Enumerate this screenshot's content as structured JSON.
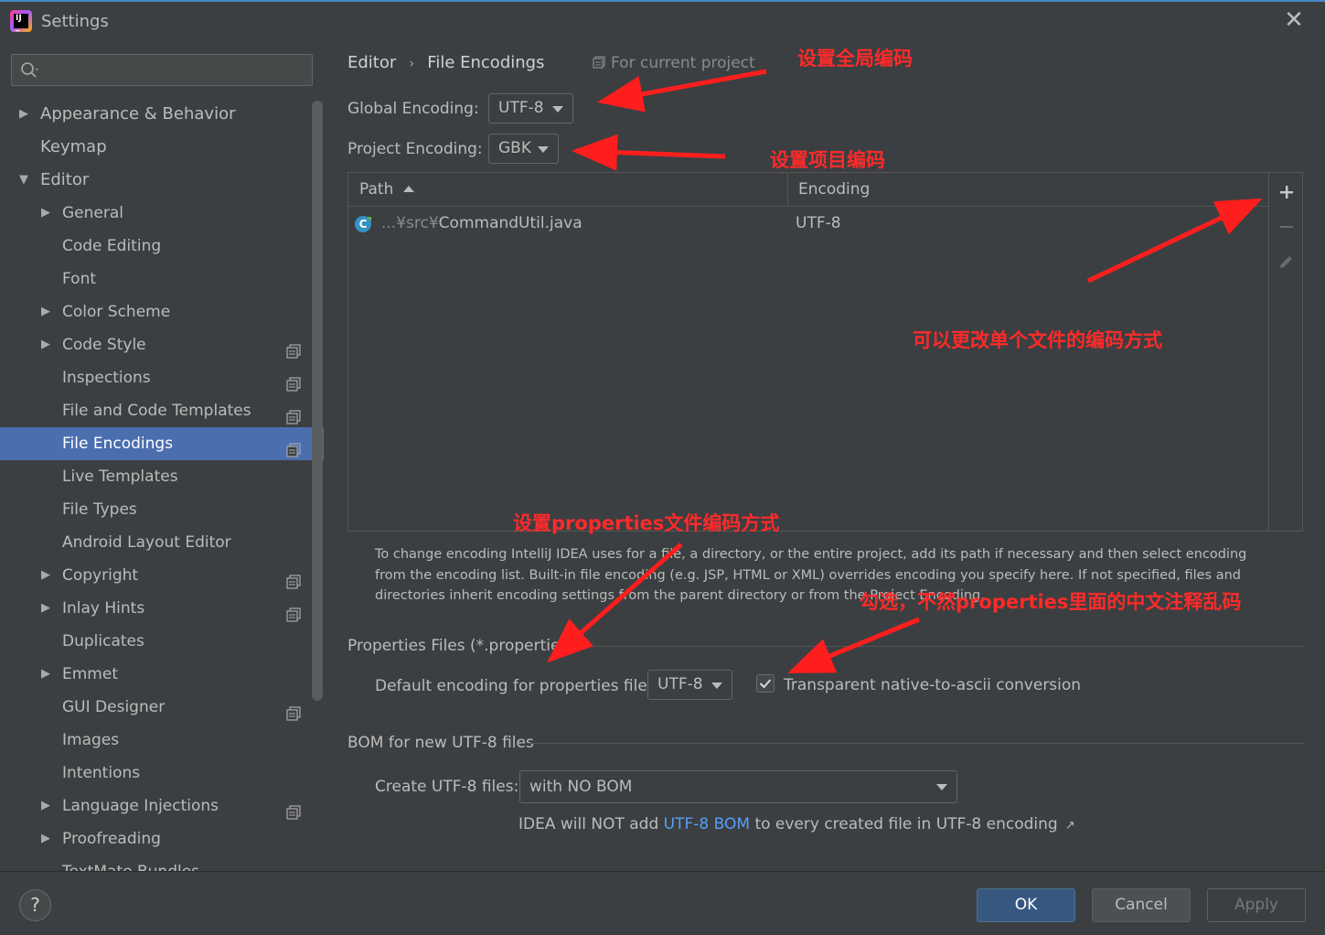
{
  "window": {
    "title": "Settings",
    "close_glyph": "✕"
  },
  "search": {
    "placeholder": "",
    "icon": "search-icon"
  },
  "sidebar": {
    "items": [
      {
        "label": "Appearance & Behavior",
        "level": 0,
        "arrow": "▶",
        "proj": false
      },
      {
        "label": "Keymap",
        "level": 0,
        "arrow": "",
        "proj": false
      },
      {
        "label": "Editor",
        "level": 0,
        "arrow": "▼",
        "proj": false
      },
      {
        "label": "General",
        "level": 1,
        "arrow": "▶",
        "proj": false
      },
      {
        "label": "Code Editing",
        "level": 1,
        "arrow": "",
        "proj": false
      },
      {
        "label": "Font",
        "level": 1,
        "arrow": "",
        "proj": false
      },
      {
        "label": "Color Scheme",
        "level": 1,
        "arrow": "▶",
        "proj": false
      },
      {
        "label": "Code Style",
        "level": 1,
        "arrow": "▶",
        "proj": true
      },
      {
        "label": "Inspections",
        "level": 1,
        "arrow": "",
        "proj": true
      },
      {
        "label": "File and Code Templates",
        "level": 1,
        "arrow": "",
        "proj": true
      },
      {
        "label": "File Encodings",
        "level": 1,
        "arrow": "",
        "proj": true,
        "selected": true
      },
      {
        "label": "Live Templates",
        "level": 1,
        "arrow": "",
        "proj": false
      },
      {
        "label": "File Types",
        "level": 1,
        "arrow": "",
        "proj": false
      },
      {
        "label": "Android Layout Editor",
        "level": 1,
        "arrow": "",
        "proj": false
      },
      {
        "label": "Copyright",
        "level": 1,
        "arrow": "▶",
        "proj": true
      },
      {
        "label": "Inlay Hints",
        "level": 1,
        "arrow": "▶",
        "proj": true
      },
      {
        "label": "Duplicates",
        "level": 1,
        "arrow": "",
        "proj": false
      },
      {
        "label": "Emmet",
        "level": 1,
        "arrow": "▶",
        "proj": false
      },
      {
        "label": "GUI Designer",
        "level": 1,
        "arrow": "",
        "proj": true
      },
      {
        "label": "Images",
        "level": 1,
        "arrow": "",
        "proj": false
      },
      {
        "label": "Intentions",
        "level": 1,
        "arrow": "",
        "proj": false
      },
      {
        "label": "Language Injections",
        "level": 1,
        "arrow": "▶",
        "proj": true
      },
      {
        "label": "Proofreading",
        "level": 1,
        "arrow": "▶",
        "proj": false
      },
      {
        "label": "TextMate Bundles",
        "level": 1,
        "arrow": "",
        "proj": false
      }
    ]
  },
  "breadcrumb": {
    "parent": "Editor",
    "separator": "›",
    "current": "File Encodings",
    "scope": "For current project"
  },
  "encodings": {
    "global_label": "Global Encoding:",
    "global_value": "UTF-8",
    "project_label": "Project Encoding:",
    "project_value": "GBK"
  },
  "table": {
    "col_path": "Path",
    "col_encoding": "Encoding",
    "rows": [
      {
        "path_prefix": "...¥src¥",
        "path_file": "CommandUtil.java",
        "encoding": "UTF-8"
      }
    ],
    "toolbar": {
      "add": "+",
      "remove": "−"
    }
  },
  "help_text": "To change encoding IntelliJ IDEA uses for a file, a directory, or the entire project, add its path if necessary and then select encoding from the encoding list. Built-in file encoding (e.g. JSP, HTML or XML) overrides encoding you specify here. If not specified, files and directories inherit encoding settings from the parent directory or from the Project Encoding.",
  "properties": {
    "section_title": "Properties Files (*.properties)",
    "default_label": "Default encoding for properties files:",
    "default_value": "UTF-8",
    "checkbox_checked": true,
    "checkbox_label": "Transparent native-to-ascii conversion"
  },
  "bom": {
    "section_title": "BOM for new UTF-8 files",
    "create_label": "Create UTF-8 files:",
    "create_value": "with NO BOM",
    "note_prefix": "IDEA will NOT add",
    "note_link": "UTF-8 BOM",
    "note_suffix": "to every created file in UTF-8 encoding",
    "ext_glyph": "↗"
  },
  "footer": {
    "help": "?",
    "ok": "OK",
    "cancel": "Cancel",
    "apply": "Apply"
  },
  "annotations": {
    "global": "设置全局编码",
    "project": "设置项目编码",
    "single_file": "可以更改单个文件的编码方式",
    "properties": "设置properties文件编码方式",
    "checkbox": "勾选，不然properties里面的中文注释乱码"
  },
  "colors": {
    "accent": "#4b6eaf",
    "ok_button": "#365880",
    "link": "#589df6",
    "annotation": "#ff2a2a"
  }
}
